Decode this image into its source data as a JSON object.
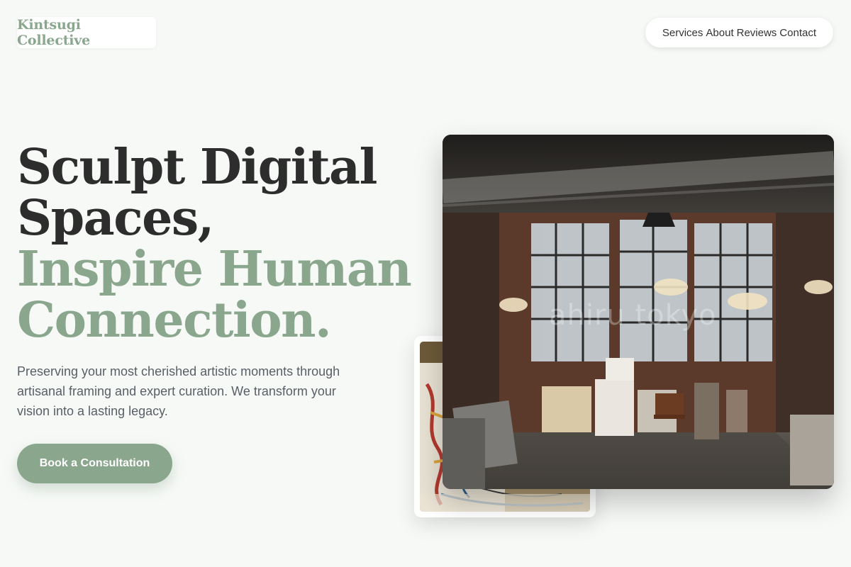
{
  "brand": {
    "name": "Kintsugi Collective",
    "accent": "#8aa78e"
  },
  "nav": {
    "items": [
      {
        "label": "Services"
      },
      {
        "label": "About"
      },
      {
        "label": "Reviews"
      },
      {
        "label": "Contact"
      }
    ]
  },
  "hero": {
    "headline_line1": "Sculpt Digital",
    "headline_line2": "Spaces,",
    "headline_line3": "Inspire Human",
    "headline_line4": "Connection.",
    "lead": "Preserving your most cherished artistic moments through artisanal framing and expert curation. We transform your vision into a lasting legacy.",
    "cta_label": "Book a Consultation"
  },
  "gallery": {
    "main_image_watermark": "ahiru tokyo",
    "main_image_icon": "artist-studio-photo",
    "secondary_image_icon": "painting-detail-photo"
  }
}
